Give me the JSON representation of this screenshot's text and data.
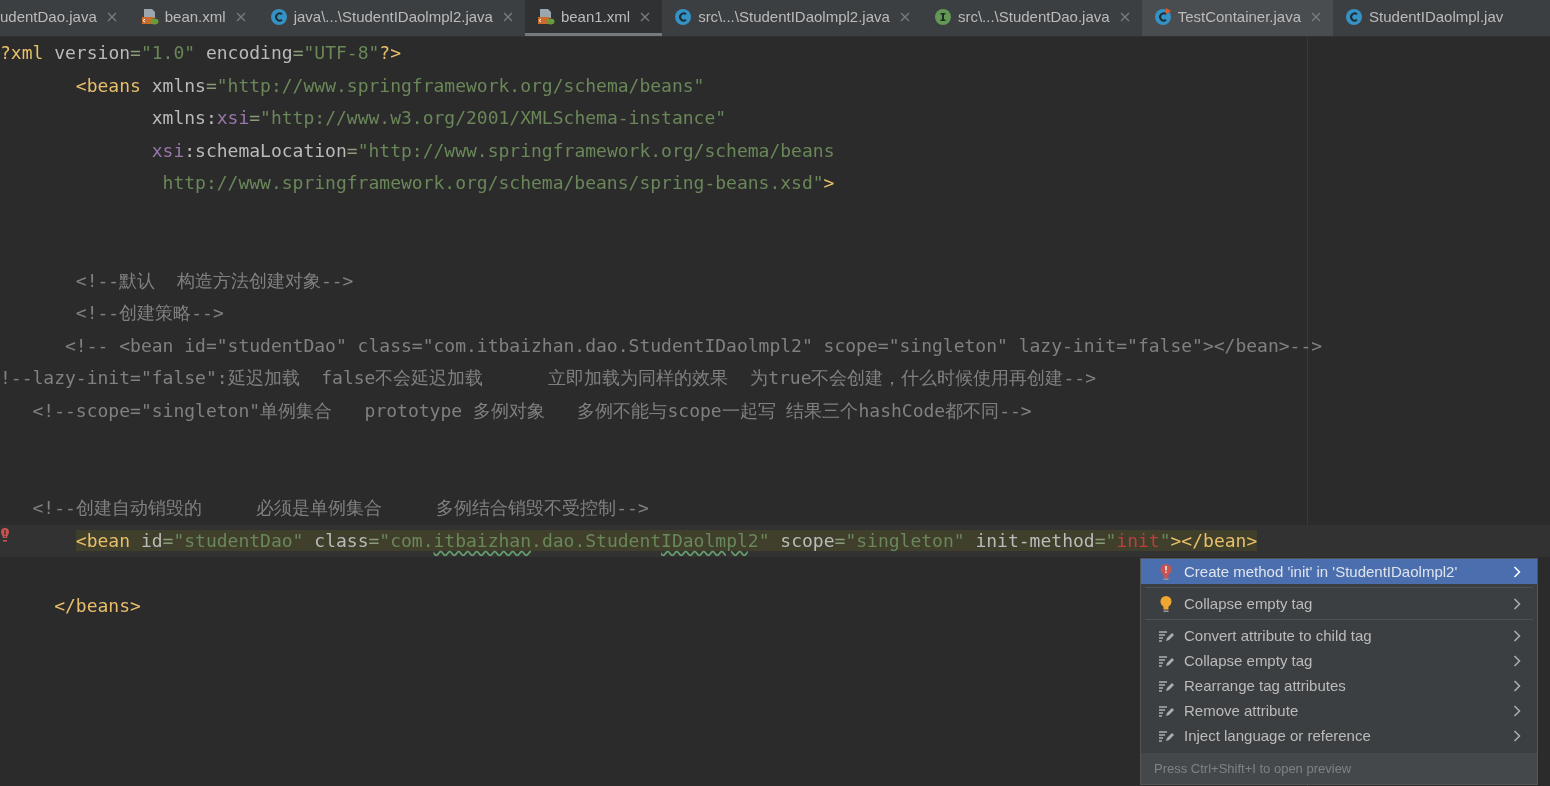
{
  "tabs": [
    {
      "label": "udentDao.java",
      "kind": "none",
      "selected": false,
      "hovered": false,
      "closable": true
    },
    {
      "label": "bean.xml",
      "kind": "xml",
      "selected": false,
      "hovered": false,
      "closable": true
    },
    {
      "label": "java\\...\\StudentIDaolmpl2.java",
      "kind": "class",
      "selected": false,
      "hovered": false,
      "closable": true
    },
    {
      "label": "bean1.xml",
      "kind": "xml",
      "selected": true,
      "hovered": false,
      "closable": true
    },
    {
      "label": "src\\...\\StudentIDaolmpl2.java",
      "kind": "class",
      "selected": false,
      "hovered": false,
      "closable": true
    },
    {
      "label": "src\\...\\StudentDao.java",
      "kind": "interface",
      "selected": false,
      "hovered": false,
      "closable": true
    },
    {
      "label": "TestContainer.java",
      "kind": "class-run",
      "selected": false,
      "hovered": true,
      "closable": true
    },
    {
      "label": "StudentIDaolmpl.jav",
      "kind": "class",
      "selected": false,
      "hovered": false,
      "closable": false
    }
  ],
  "editor": {
    "sections": [
      {
        "lines": [
          {
            "highlighted": false,
            "error": false,
            "tokens": [
              {
                "kind": "tag",
                "text": "?xml"
              },
              {
                "kind": "attr",
                "text": " version"
              },
              {
                "kind": "eq",
                "text": "="
              },
              {
                "kind": "str",
                "text": "\"1.0\""
              },
              {
                "kind": "attr",
                "text": " encoding"
              },
              {
                "kind": "eq",
                "text": "="
              },
              {
                "kind": "str",
                "text": "\"UTF-8\""
              },
              {
                "kind": "tag",
                "text": "?>"
              }
            ]
          },
          {
            "highlighted": false,
            "error": false,
            "tokens": [
              {
                "kind": "tag",
                "text": "       <beans"
              },
              {
                "kind": "attr",
                "text": " xmlns"
              },
              {
                "kind": "eq",
                "text": "="
              },
              {
                "kind": "str",
                "text": "\"http://www.springframework.org/schema/beans\""
              }
            ]
          },
          {
            "highlighted": false,
            "error": false,
            "tokens": [
              {
                "kind": "attr",
                "text": "              xmlns:"
              },
              {
                "kind": "ns",
                "text": "xsi"
              },
              {
                "kind": "eq",
                "text": "="
              },
              {
                "kind": "str",
                "text": "\"http://www.w3.org/2001/XMLSchema-instance\""
              }
            ]
          },
          {
            "highlighted": false,
            "error": false,
            "tokens": [
              {
                "kind": "ns",
                "text": "              xsi"
              },
              {
                "kind": "attr",
                "text": ":schemaLocation"
              },
              {
                "kind": "eq",
                "text": "="
              },
              {
                "kind": "str",
                "text": "\"http://www.springframework.org/schema/beans"
              }
            ]
          },
          {
            "highlighted": false,
            "error": false,
            "tokens": [
              {
                "kind": "str",
                "text": "               http://www.springframework.org/schema/beans/spring-beans.xsd\""
              },
              {
                "kind": "tag",
                "text": ">"
              }
            ]
          }
        ]
      },
      {
        "lines": [
          {
            "highlighted": false,
            "error": false,
            "tokens": [
              {
                "kind": "comment",
                "text": "       <!--默认  构造方法创建对象-->"
              }
            ]
          },
          {
            "highlighted": false,
            "error": false,
            "tokens": [
              {
                "kind": "comment",
                "text": "       <!--创建策略-->"
              }
            ]
          },
          {
            "highlighted": false,
            "error": false,
            "tokens": [
              {
                "kind": "comment",
                "text": "      <!-- <bean id=\"studentDao\" class=\"com.itbaizhan.dao.StudentIDaolmpl2\" scope=\"singleton\" lazy-init=\"false\"></bean>-->"
              }
            ]
          },
          {
            "highlighted": false,
            "error": false,
            "tokens": [
              {
                "kind": "comment",
                "text": "!--lazy-init=\"false\":延迟加载  false不会延迟加载      立即加载为同样的效果  为true不会创建，什么时候使用再创建-->"
              }
            ]
          },
          {
            "highlighted": false,
            "error": false,
            "tokens": [
              {
                "kind": "comment",
                "text": "   <!--scope=\"singleton\"单例集合   prototype 多例对象   多例不能与scope一起写 结果三个hashCode都不同-->"
              }
            ]
          }
        ]
      },
      {
        "lines": [
          {
            "highlighted": false,
            "error": false,
            "tokens": [
              {
                "kind": "comment",
                "text": "   <!--创建自动销毁的     必须是单例集合     多例结合销毁不受控制-->"
              }
            ]
          },
          {
            "highlighted": true,
            "error": true,
            "tokens": [
              {
                "kind": "tag",
                "text": "       <bean"
              },
              {
                "kind": "attr",
                "text": " id"
              },
              {
                "kind": "eq",
                "text": "="
              },
              {
                "kind": "str",
                "text": "\"studentDao\""
              },
              {
                "kind": "attr",
                "text": " class"
              },
              {
                "kind": "eq",
                "text": "="
              },
              {
                "kind": "str",
                "text": "\"com."
              },
              {
                "kind": "typo",
                "text": "itbaizhan"
              },
              {
                "kind": "str",
                "text": ".dao.Student"
              },
              {
                "kind": "typo",
                "text": "IDaolmpl"
              },
              {
                "kind": "str",
                "text": "2\""
              },
              {
                "kind": "attr",
                "text": " scope"
              },
              {
                "kind": "eq",
                "text": "="
              },
              {
                "kind": "str",
                "text": "\"singleton\""
              },
              {
                "kind": "attr",
                "text": " init-method"
              },
              {
                "kind": "eq",
                "text": "="
              },
              {
                "kind": "str",
                "text": "\""
              },
              {
                "kind": "err",
                "text": "init"
              },
              {
                "kind": "str",
                "text": "\""
              },
              {
                "kind": "tag",
                "text": "></bean>"
              }
            ]
          }
        ]
      }
    ],
    "closing_line": {
      "highlighted": false,
      "error": false,
      "tokens": [
        {
          "kind": "tag",
          "text": "     </beans>"
        }
      ]
    }
  },
  "popup": {
    "groups": [
      [
        {
          "label": "Create method 'init' in 'StudentIDaolmpl2'",
          "kind": "error",
          "selected": true
        }
      ],
      [
        {
          "label": "Collapse empty tag",
          "kind": "bulb",
          "selected": false
        }
      ],
      [
        {
          "label": "Convert attribute to child tag",
          "kind": "intention",
          "selected": false
        },
        {
          "label": "Collapse empty tag",
          "kind": "intention",
          "selected": false
        },
        {
          "label": "Rearrange tag attributes",
          "kind": "intention",
          "selected": false
        },
        {
          "label": "Remove attribute",
          "kind": "intention",
          "selected": false
        },
        {
          "label": "Inject language or reference",
          "kind": "intention",
          "selected": false
        }
      ]
    ],
    "hint": "Press Ctrl+Shift+I to open preview"
  }
}
